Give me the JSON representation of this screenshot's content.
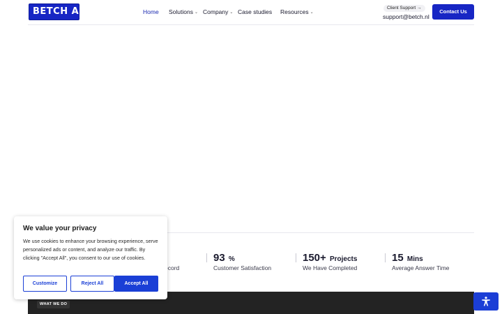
{
  "header": {
    "logo_text": "BETCH AI",
    "nav": [
      {
        "label": "Home",
        "active": true,
        "has_dropdown": false
      },
      {
        "label": "Solutions",
        "active": false,
        "has_dropdown": true
      },
      {
        "label": "Company",
        "active": false,
        "has_dropdown": true
      },
      {
        "label": "Case studies",
        "active": false,
        "has_dropdown": false
      },
      {
        "label": "Resources",
        "active": false,
        "has_dropdown": true
      }
    ],
    "dropdown_glyph": "⌄",
    "client_support_label": "Client Support →",
    "support_email": "support@betch.nl",
    "contact_button": "Contact Us"
  },
  "stats": {
    "partial_label": "ecord",
    "items": [
      {
        "value": "93",
        "unit": "%",
        "label": "Customer Satisfaction"
      },
      {
        "value": "150+",
        "unit": "Projects",
        "label": "We Have Completed"
      },
      {
        "value": "15",
        "unit": "Mins",
        "label": "Average Answer Time"
      }
    ]
  },
  "section": {
    "eyebrow": "WHAT WE DO"
  },
  "cookie_banner": {
    "title": "We value your privacy",
    "body": "We use cookies to enhance your browsing experience, serve personalized ads or content, and analyze our traffic. By clicking \"Accept All\", you consent to our use of cookies.",
    "customize": "Customize",
    "reject": "Reject All",
    "accept": "Accept All"
  },
  "accessibility": {
    "icon": "accessibility-person-icon"
  },
  "colors": {
    "brand": "#1726c4",
    "cookie_accent": "#1a3fd6",
    "dark_section": "#232323",
    "nav_active": "#1c2bb0"
  }
}
